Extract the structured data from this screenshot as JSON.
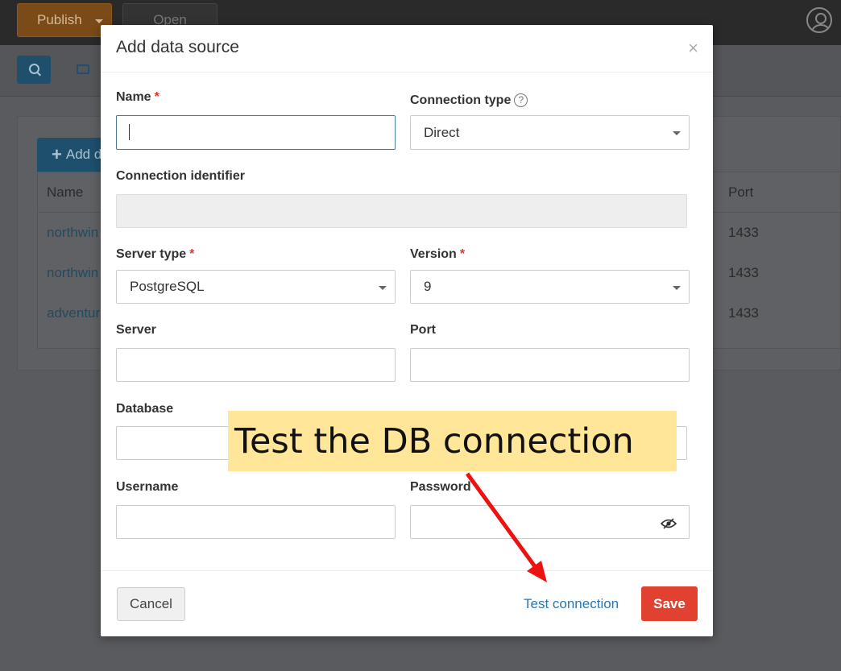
{
  "app": {
    "publish_label": "Publish",
    "open_label": "Open",
    "add_label": "Add d",
    "table": {
      "col_name": "Name",
      "col_port": "Port",
      "rows": [
        {
          "name": "northwin",
          "port": "1433"
        },
        {
          "name": "northwin",
          "port": "1433"
        },
        {
          "name": "adventur",
          "port": "1433"
        }
      ]
    }
  },
  "dialog": {
    "title": "Add data source",
    "close": "×",
    "fields": {
      "name": {
        "label": "Name",
        "required": "*",
        "value": ""
      },
      "connection_type": {
        "label": "Connection type",
        "help": "?",
        "value": "Direct"
      },
      "connection_identifier": {
        "label": "Connection identifier",
        "value": ""
      },
      "server_type": {
        "label": "Server type",
        "required": "*",
        "value": "PostgreSQL"
      },
      "version": {
        "label": "Version",
        "required": "*",
        "value": "9"
      },
      "server": {
        "label": "Server",
        "value": ""
      },
      "port": {
        "label": "Port",
        "value": ""
      },
      "database": {
        "label": "Database",
        "value": ""
      },
      "username": {
        "label": "Username",
        "value": ""
      },
      "password": {
        "label": "Password",
        "value": ""
      }
    },
    "buttons": {
      "cancel": "Cancel",
      "test": "Test connection",
      "save": "Save"
    }
  },
  "annotation": {
    "text": "Test the DB connection"
  },
  "colors": {
    "save": "#e04131",
    "link": "#2a77b3",
    "callout": "#ffe699",
    "arrow": "#ee1111"
  }
}
